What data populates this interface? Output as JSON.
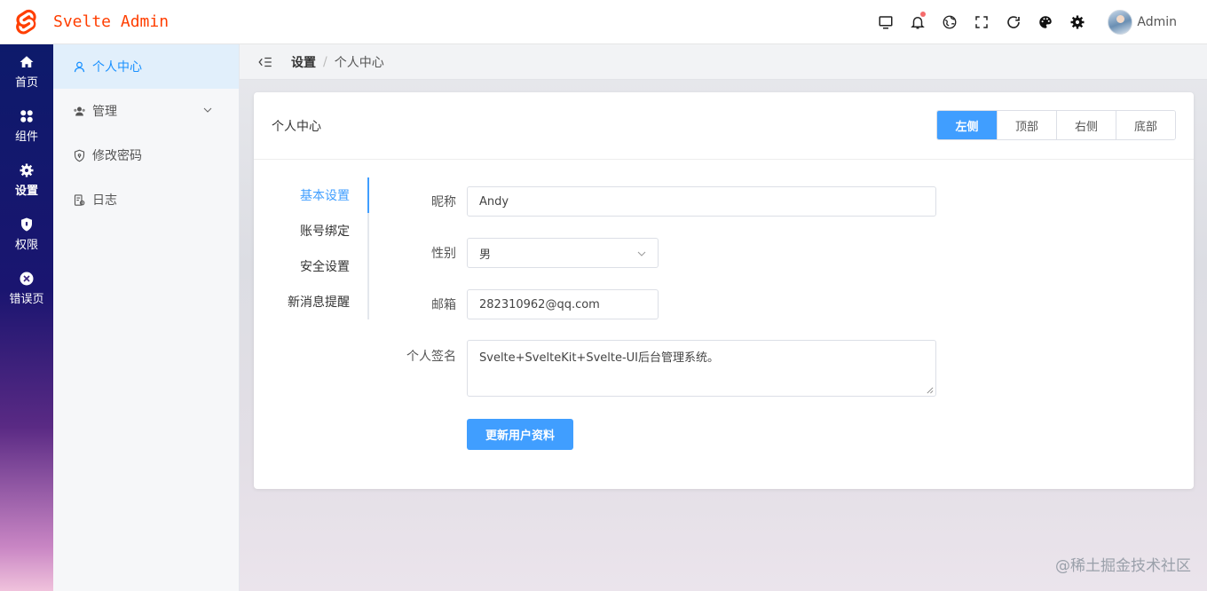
{
  "app": {
    "title": "Svelte Admin",
    "brand_color": "#ff3e00"
  },
  "header": {
    "tools": [
      "monitor-icon",
      "bell-icon",
      "language-icon",
      "fullscreen-icon",
      "refresh-icon",
      "palette-icon",
      "gear-icon"
    ],
    "user_name": "Admin"
  },
  "nav": {
    "items": [
      {
        "label": "首页",
        "icon": "home-icon"
      },
      {
        "label": "组件",
        "icon": "grid-icon"
      },
      {
        "label": "设置",
        "icon": "gear-icon"
      },
      {
        "label": "权限",
        "icon": "shield-icon"
      },
      {
        "label": "错误页",
        "icon": "close-circle-icon"
      }
    ]
  },
  "submenu": {
    "items": [
      {
        "label": "个人中心",
        "icon": "user-icon"
      },
      {
        "label": "管理",
        "icon": "users-icon"
      },
      {
        "label": "修改密码",
        "icon": "shield-lock-icon"
      },
      {
        "label": "日志",
        "icon": "log-icon"
      }
    ]
  },
  "breadcrumb": {
    "parent": "设置",
    "separator": "/",
    "current": "个人中心"
  },
  "card": {
    "title": "个人中心",
    "positions": [
      "左侧",
      "顶部",
      "右侧",
      "底部"
    ],
    "active_position": "左侧"
  },
  "tabs": [
    "基本设置",
    "账号绑定",
    "安全设置",
    "新消息提醒"
  ],
  "form": {
    "nickname": {
      "label": "昵称",
      "value": "Andy"
    },
    "gender": {
      "label": "性别",
      "value": "男"
    },
    "email": {
      "label": "邮箱",
      "value": "282310962@qq.com"
    },
    "signature": {
      "label": "个人签名",
      "value": "Svelte+SvelteKit+Svelte-UI后台管理系统。"
    },
    "submit_label": "更新用户资料"
  },
  "watermark": "@稀土掘金技术社区",
  "colors": {
    "primary": "#409eff",
    "active_bg": "#e1effb",
    "badge": "#f56c6c"
  }
}
